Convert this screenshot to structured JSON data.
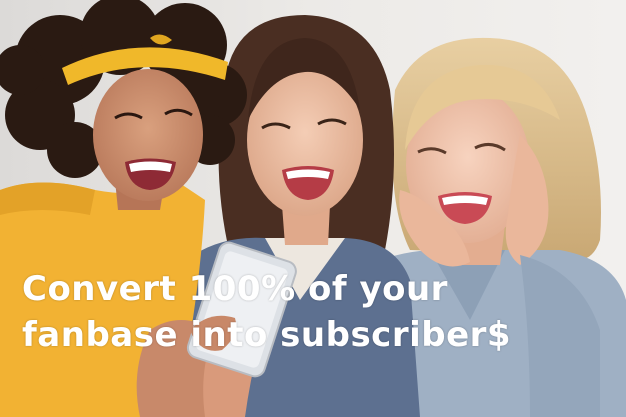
{
  "headline": {
    "line1": "Convert 100% of your",
    "line2": "fanbase into subscriber$"
  },
  "colors": {
    "background": "#e8e6e3",
    "text": "#ffffff",
    "left_shirt": "#f2b233",
    "headband": "#f0b82a",
    "middle_jacket": "#5d7090",
    "right_shirt": "#9fb0c4"
  }
}
